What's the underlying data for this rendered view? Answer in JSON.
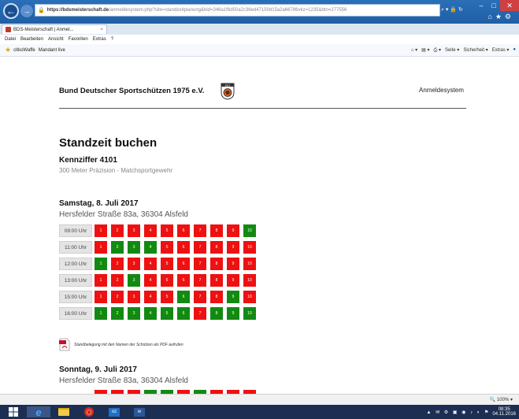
{
  "browser": {
    "url_host": "https://bdsmeisterschaft.de",
    "url_rest": "/anmeldesystem.php?site=standzeitplanung&bid=346a1f6d50a2c36ed47150d15a2a66786vkz=1235&btn=277556",
    "tab_title": "BDS-Meisterschaft | Anmel...",
    "tab_close": "×",
    "menu": [
      "Datei",
      "Bearbeiten",
      "Ansicht",
      "Favoriten",
      "Extras",
      "?"
    ],
    "favorites": [
      "citkoWaffe",
      "Mandant live"
    ],
    "commands": [
      "Seite ▾",
      "Sicherheit ▾",
      "Extras ▾"
    ],
    "zoom": "100%"
  },
  "header": {
    "org_name": "Bund Deutscher Sportschützen 1975 e.V.",
    "logo_text": "BDS",
    "system_name": "Anmeldesystem"
  },
  "main": {
    "title": "Standzeit buchen",
    "code": "Kennziffer 4101",
    "discipline": "300 Meter Präzision - Matchsportgewehr",
    "pdf_link": "Standbelegung mit den Namen der Schützen als PDF aufrufen"
  },
  "days": [
    {
      "title": "Samstag, 8. Juli 2017",
      "address": "Hersfelder Straße 83a, 36304 Alsfeld",
      "slots": [
        {
          "time": "09:00 Uhr",
          "lanes": [
            "busy",
            "busy",
            "busy",
            "busy",
            "busy",
            "busy",
            "busy",
            "busy",
            "busy",
            "free"
          ]
        },
        {
          "time": "11:00 Uhr",
          "lanes": [
            "busy",
            "free",
            "free",
            "free",
            "busy",
            "busy",
            "busy",
            "busy",
            "busy",
            "busy"
          ]
        },
        {
          "time": "12:00 Uhr",
          "lanes": [
            "free",
            "busy",
            "busy",
            "busy",
            "busy",
            "busy",
            "busy",
            "busy",
            "busy",
            "busy"
          ]
        },
        {
          "time": "13:00 Uhr",
          "lanes": [
            "busy",
            "busy",
            "free",
            "busy",
            "busy",
            "busy",
            "busy",
            "busy",
            "busy",
            "busy"
          ]
        },
        {
          "time": "15:00 Uhr",
          "lanes": [
            "busy",
            "busy",
            "busy",
            "busy",
            "busy",
            "free",
            "busy",
            "busy",
            "free",
            "busy"
          ]
        },
        {
          "time": "16:00 Uhr",
          "lanes": [
            "free",
            "free",
            "free",
            "free",
            "free",
            "free",
            "busy",
            "free",
            "free",
            "free"
          ]
        }
      ]
    },
    {
      "title": "Sonntag, 9. Juli 2017",
      "address": "Hersfelder Straße 83a, 36304 Alsfeld",
      "partial_lanes": [
        "busy",
        "busy",
        "busy",
        "free",
        "free",
        "busy",
        "free",
        "busy",
        "busy",
        "busy"
      ]
    }
  ],
  "lane_labels": [
    "1",
    "2",
    "3",
    "4",
    "5",
    "6",
    "7",
    "8",
    "9",
    "10"
  ],
  "colors": {
    "free": "#128a12",
    "busy": "#ee1111"
  },
  "taskbar": {
    "clock": "08:35",
    "date": "04.11.2016"
  }
}
